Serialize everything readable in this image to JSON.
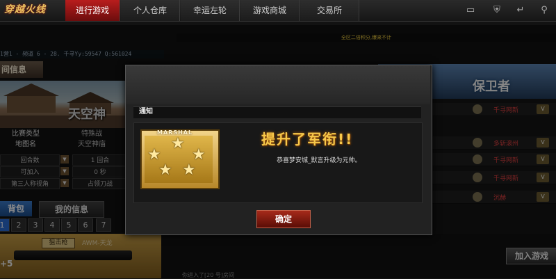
{
  "app": {
    "logo": "穿越火线"
  },
  "nav": {
    "tabs": [
      "进行游戏",
      "个人仓库",
      "幸运左轮",
      "游戏商城",
      "交易所"
    ],
    "active_index": 0,
    "icons": [
      "tv-icon",
      "shield-icon",
      "back-icon",
      "settings-icon"
    ]
  },
  "left": {
    "channel": "1营1 - 频道 6 - 28. 千寻Yy:59547     Q:561024",
    "room_info_tab": "间信息",
    "map_overlay": "天空神",
    "info": [
      {
        "key": "比赛类型",
        "value": "特殊战"
      },
      {
        "key": "地图名",
        "value": "天空神庙"
      }
    ],
    "options": [
      {
        "a": "回合数",
        "b": "1 回合"
      },
      {
        "a": "可加入",
        "b": "0 秒"
      },
      {
        "a": "第三人称视角",
        "b": "占领刀战"
      }
    ],
    "bag_tab": "背包",
    "myinfo_tab": "我的信息",
    "slots": [
      "1",
      "2",
      "3",
      "4",
      "5",
      "6",
      "7"
    ],
    "weapon": {
      "badge": "狙击枪",
      "name": "AWM-天龙",
      "plus": "+5"
    }
  },
  "right": {
    "announcement": "全区二倍积分,爆来不计",
    "defend_title": "保卫者",
    "players": [
      {
        "name": "千寻网新"
      },
      {
        "name": "多斩滚州"
      },
      {
        "name": "千寻网新"
      },
      {
        "name": "千寻网新"
      },
      {
        "name": "沉赫"
      }
    ],
    "join_button": "加入游戏",
    "chat": "你进入了[20 号]房间"
  },
  "modal": {
    "title": "通知",
    "badge_label": "MARSHAL",
    "headline": "提升了军衔!!",
    "message": "恭喜梦安城_默言升级为元帅。",
    "confirm": "确定"
  }
}
